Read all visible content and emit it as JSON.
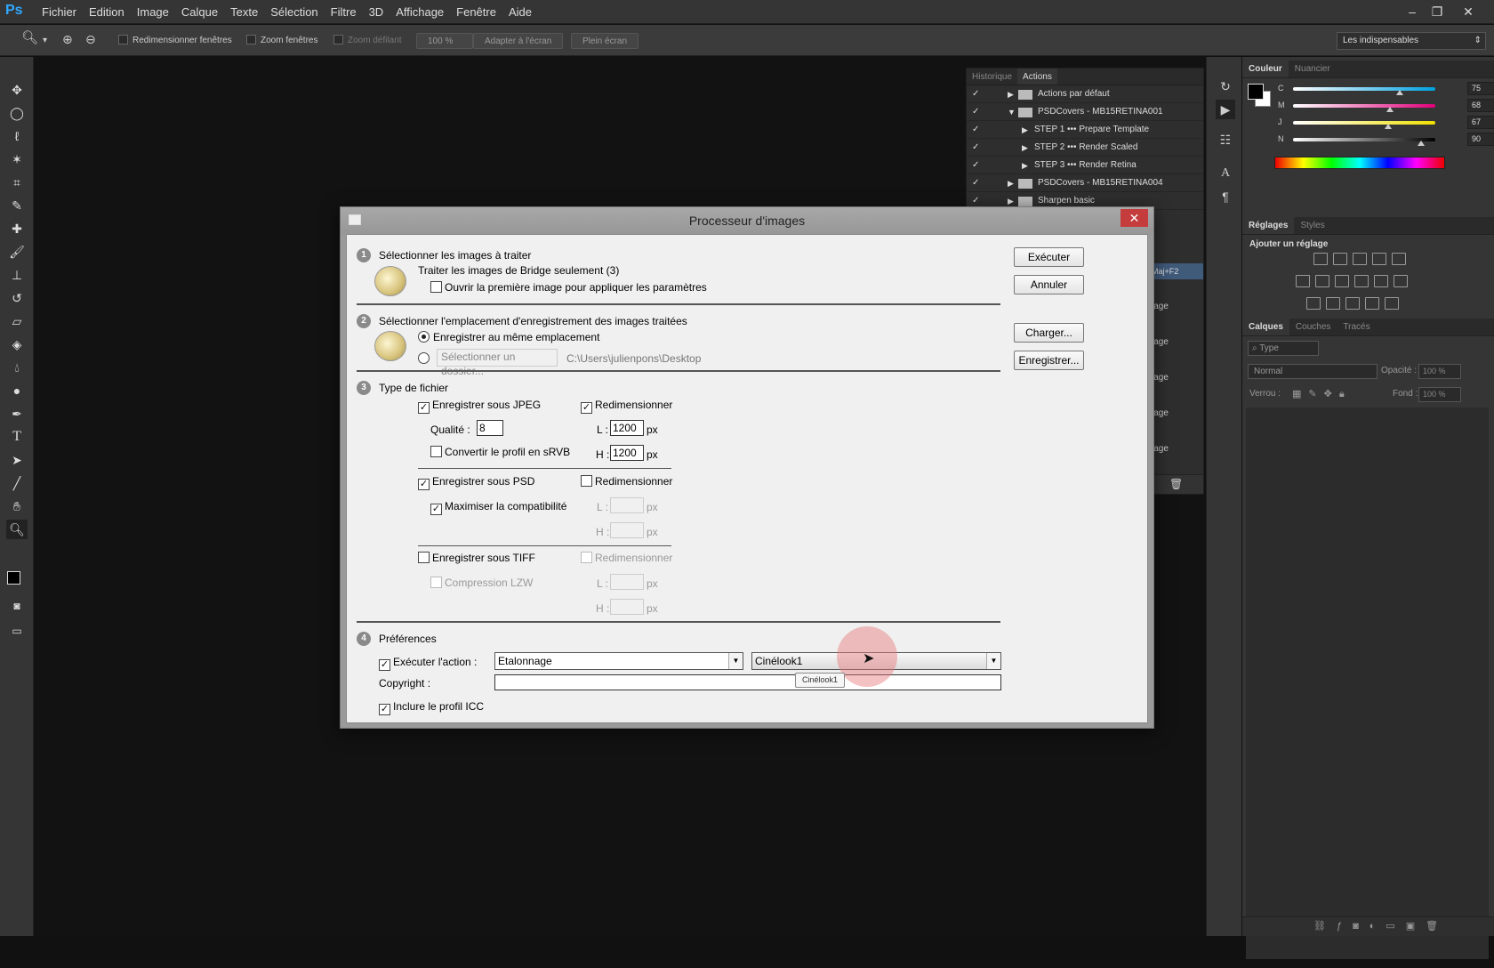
{
  "app": {
    "logo": "Ps"
  },
  "menu": [
    "Fichier",
    "Edition",
    "Image",
    "Calque",
    "Texte",
    "Sélection",
    "Filtre",
    "3D",
    "Affichage",
    "Fenêtre",
    "Aide"
  ],
  "window_controls": {
    "minimize": "–",
    "restore": "❐",
    "close": "✕"
  },
  "options_bar": {
    "resize_windows": "Redimensionner fenêtres",
    "zoom_windows": "Zoom fenêtres",
    "scrubby_zoom": "Zoom défilant",
    "zoom_value": "100 %",
    "fit_screen": "Adapter à l'écran",
    "full_screen": "Plein écran",
    "workspace": "Les indispensables"
  },
  "actions_panel": {
    "tabs": [
      "Historique",
      "Actions"
    ],
    "rows": [
      {
        "label": "Actions par défaut",
        "level": 0,
        "folder": true,
        "expanded": false
      },
      {
        "label": "PSDCovers - MB15RETINA001",
        "level": 0,
        "folder": true,
        "expanded": true
      },
      {
        "label": "STEP 1 ••• Prepare Template",
        "level": 1,
        "folder": false,
        "expanded": false
      },
      {
        "label": "STEP 2 ••• Render Scaled",
        "level": 1,
        "folder": false,
        "expanded": false
      },
      {
        "label": "STEP 3 ••• Render Retina",
        "level": 1,
        "folder": false,
        "expanded": false
      },
      {
        "label": "PSDCovers - MB15RETINA004",
        "level": 0,
        "folder": true,
        "expanded": false
      },
      {
        "label": "Sharpen basic",
        "level": 0,
        "folder": true,
        "expanded": false
      }
    ],
    "partial_labels": [
      "Maj+F2",
      "lage",
      "lage",
      "lage",
      "lage",
      "lage"
    ]
  },
  "color_panel": {
    "tabs": [
      "Couleur",
      "Nuancier"
    ],
    "sliders": [
      {
        "label": "C",
        "value": "75",
        "unit": "%",
        "color": "#00a0e0",
        "level": 0.75
      },
      {
        "label": "M",
        "value": "68",
        "unit": "%",
        "color": "#e0007a",
        "level": 0.68
      },
      {
        "label": "J",
        "value": "67",
        "unit": "%",
        "color": "#f0e000",
        "level": 0.67
      },
      {
        "label": "N",
        "value": "90",
        "unit": "%",
        "color": "#000000",
        "level": 0.9
      }
    ]
  },
  "adjustments_panel": {
    "tabs": [
      "Réglages",
      "Styles"
    ],
    "heading": "Ajouter un réglage"
  },
  "layers_panel": {
    "tabs": [
      "Calques",
      "Couches",
      "Tracés"
    ],
    "filter": "Type",
    "blend_mode": "Normal",
    "opacity_label": "Opacité :",
    "opacity_value": "100 %",
    "lock_label": "Verrou :",
    "fill_label": "Fond :",
    "fill_value": "100 %"
  },
  "dialog": {
    "title": "Processeur d'images",
    "s1": {
      "num": "1",
      "heading": "Sélectionner les images à traiter",
      "bridge_text": "Traiter les images de Bridge seulement (3)",
      "open_first": "Ouvrir la première image pour appliquer les paramètres"
    },
    "s2": {
      "num": "2",
      "heading": "Sélectionner l'emplacement d'enregistrement des images traitées",
      "same_location": "Enregistrer au même emplacement",
      "select_folder": "Sélectionner un dossier...",
      "path": "C:\\Users\\julienpons\\Desktop"
    },
    "s3": {
      "num": "3",
      "heading": "Type de fichier",
      "jpeg": "Enregistrer sous JPEG",
      "resize": "Redimensionner",
      "quality_label": "Qualité :",
      "quality_value": "8",
      "w_label": "L :",
      "h_label": "H :",
      "px": "px",
      "jpeg_w": "1200",
      "jpeg_h": "1200",
      "srgb": "Convertir le profil en sRVB",
      "psd": "Enregistrer sous PSD",
      "maximize": "Maximiser la compatibilité",
      "tiff": "Enregistrer sous TIFF",
      "lzw": "Compression LZW"
    },
    "s4": {
      "num": "4",
      "heading": "Préférences",
      "run_action": "Exécuter l'action :",
      "action_set": "Etalonnage",
      "action": "Cinélook1",
      "copyright_label": "Copyright :",
      "copyright_value": "",
      "icc": "Inclure le profil ICC"
    },
    "buttons": {
      "run": "Exécuter",
      "cancel": "Annuler",
      "load": "Charger...",
      "save": "Enregistrer..."
    },
    "tooltip": "Cinélook1"
  }
}
